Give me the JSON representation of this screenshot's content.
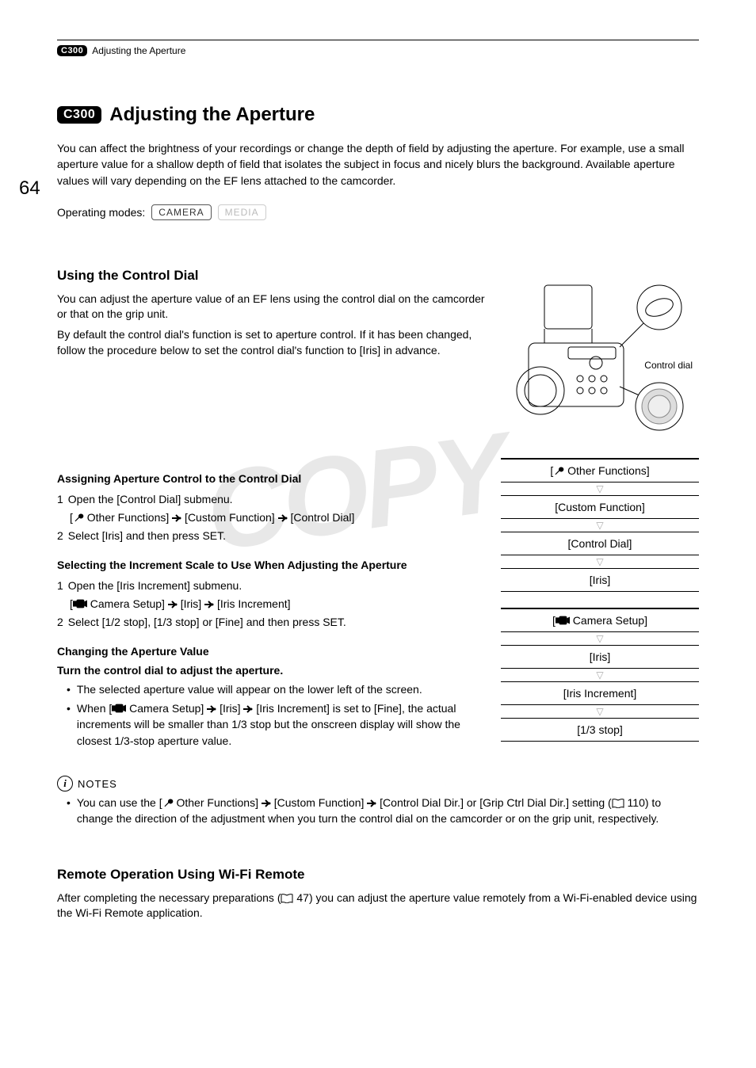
{
  "pageNumber": "64",
  "modelBadge": "C300",
  "runningHead": "Adjusting the Aperture",
  "title": "Adjusting the Aperture",
  "intro": "You can affect the brightness of your recordings or change the depth of field by adjusting the aperture. For example, use a small aperture value for a shallow depth of field that isolates the subject in focus and nicely blurs the background. Available aperture values will vary depending on the EF lens attached to the camcorder.",
  "opModesLabel": "Operating modes:",
  "modes": {
    "camera": "CAMERA",
    "media": "MEDIA"
  },
  "watermark": "COPY",
  "section1": {
    "heading": "Using the Control Dial",
    "body1": "You can adjust the aperture value of an EF lens using the control dial on the camcorder or that on the grip unit.",
    "body2": "By default the control dial's function is set to aperture control. If it has been changed, follow the procedure below to set the control dial's function to [Iris] in advance.",
    "diagramLabel": "Control dial"
  },
  "assign": {
    "heading": "Assigning Aperture Control to the Control Dial",
    "step1": "Open the [Control Dial] submenu.",
    "step1pathA": " Other Functions] ",
    "step1pathB": " [Custom Function] ",
    "step1pathC": " [Control Dial]",
    "step2": "Select [Iris] and then press SET."
  },
  "selectInc": {
    "heading": "Selecting the Increment Scale to Use When Adjusting the Aperture",
    "step1": "Open the [Iris Increment] submenu.",
    "step1pathA": " Camera Setup] ",
    "step1pathB": " [Iris] ",
    "step1pathC": " [Iris Increment]",
    "step2": "Select [1/2 stop], [1/3 stop] or [Fine] and then press SET."
  },
  "changing": {
    "heading": "Changing the Aperture Value",
    "action": "Turn the control dial to adjust the aperture.",
    "bullet1": "The selected aperture value will appear on the lower left of the screen.",
    "bullet2a": "When [",
    "bullet2b": " Camera Setup] ",
    "bullet2c": " [Iris] ",
    "bullet2d": " [Iris Increment] is set to [Fine], the actual increments will be smaller than 1/3 stop but the onscreen display will show the closest 1/3-stop aperture value."
  },
  "notes": {
    "label": "NOTES",
    "textA": "You can use the [",
    "textB": " Other Functions] ",
    "textC": " [Custom Function] ",
    "textD": " [Control Dial Dir.] or [Grip Ctrl Dial Dir.] setting (",
    "textE": " 110) to change the direction of the adjustment when you turn the control dial on the camcorder or on the grip unit, respectively."
  },
  "menuPaths": {
    "block1": [
      "Other Functions]",
      "[Custom Function]",
      "[Control Dial]",
      "[Iris]"
    ],
    "block2": [
      "Camera Setup]",
      "[Iris]",
      "[Iris Increment]",
      "[1/3 stop]"
    ]
  },
  "remote": {
    "heading": "Remote Operation Using Wi-Fi Remote",
    "textA": "After completing the necessary preparations (",
    "textB": " 47) you can adjust the aperture value remotely from a Wi-Fi-enabled device using the Wi-Fi Remote application."
  }
}
